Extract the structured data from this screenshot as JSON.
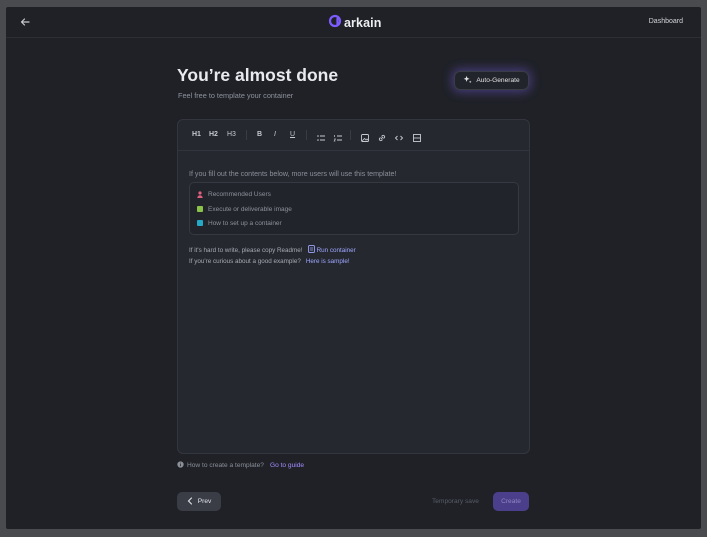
{
  "header": {
    "logo_text": "arkain",
    "dashboard_label": "Dashboard",
    "accent_color": "#7c5cff"
  },
  "page": {
    "title": "You’re almost done",
    "subtitle": "Feel free to template your container",
    "auto_generate_label": "Auto-Generate"
  },
  "toolbar": {
    "h1": "H1",
    "h2": "H2",
    "h3": "H3",
    "bold": "B",
    "italic": "I",
    "underline": "U",
    "icons": [
      "bullet-list-icon",
      "numbered-list-icon",
      "image-icon",
      "link-icon",
      "code-icon",
      "table-icon"
    ]
  },
  "editor": {
    "intro": "If you fill out the contents below, more users will use this template!",
    "checklist": [
      {
        "label": "Recommended Users",
        "icon": "person-icon",
        "color": "#e0607e"
      },
      {
        "label": "Execute or deliverable image",
        "icon": "picture-icon",
        "color": "#8bc34a"
      },
      {
        "label": "How to set up a container",
        "icon": "book-icon",
        "color": "#26a9c7"
      }
    ],
    "hint1": {
      "text": "If it's hard to write, please copy Readme!",
      "link": "Run container"
    },
    "hint2": {
      "text": "If you're curious about a good example?",
      "link": "Here is sample!"
    }
  },
  "footer": {
    "guide_text": "How to create a template?",
    "guide_link": "Go to guide",
    "prev_label": "Prev",
    "temp_save_label": "Temporary save",
    "create_label": "Create"
  }
}
